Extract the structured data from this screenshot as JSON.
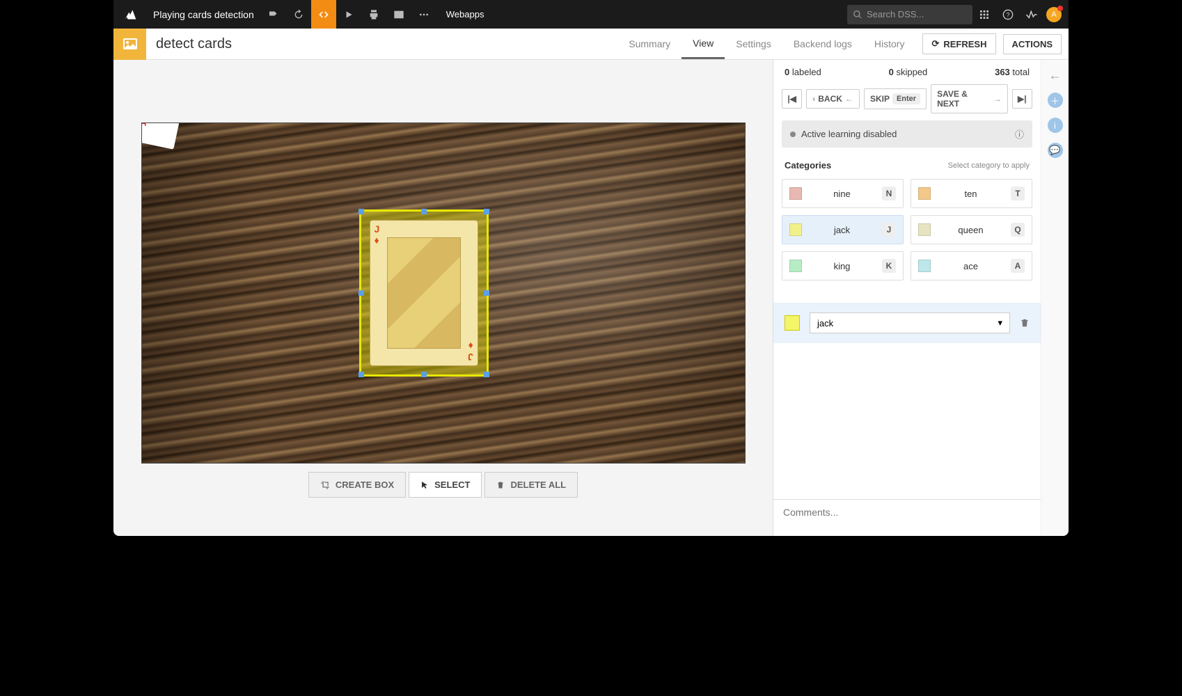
{
  "topbar": {
    "project_name": "Playing cards detection",
    "menu_webapps": "Webapps",
    "search_placeholder": "Search DSS...",
    "avatar_initial": "A"
  },
  "subheader": {
    "page_title": "detect cards",
    "tabs": {
      "summary": "Summary",
      "view": "View",
      "settings": "Settings",
      "backend_logs": "Backend logs",
      "history": "History"
    },
    "refresh": "REFRESH",
    "actions": "ACTIONS"
  },
  "stats": {
    "labeled_count": "0",
    "labeled_txt": "labeled",
    "skipped_count": "0",
    "skipped_txt": "skipped",
    "total_count": "363",
    "total_txt": "total"
  },
  "nav": {
    "back": "BACK",
    "skip": "SKIP",
    "enter": "Enter",
    "save_next": "SAVE & NEXT"
  },
  "al_banner": "Active learning disabled",
  "categories": {
    "title": "Categories",
    "hint": "Select category to apply",
    "items": [
      {
        "label": "nine",
        "key": "N",
        "color": "#e8b9b3"
      },
      {
        "label": "ten",
        "key": "T",
        "color": "#f2c98a"
      },
      {
        "label": "jack",
        "key": "J",
        "color": "#f2f08a",
        "selected": true
      },
      {
        "label": "queen",
        "key": "Q",
        "color": "#e6e4c2"
      },
      {
        "label": "king",
        "key": "K",
        "color": "#b7edc4"
      },
      {
        "label": "ace",
        "key": "A",
        "color": "#bde7ea"
      }
    ]
  },
  "applied": {
    "label": "jack",
    "color": "#f2f06a"
  },
  "tools": {
    "create_box": "CREATE BOX",
    "select": "SELECT",
    "delete_all": "DELETE ALL"
  },
  "comments_placeholder": "Comments...",
  "bbox_card": {
    "rank": "J",
    "suit": "♦"
  }
}
